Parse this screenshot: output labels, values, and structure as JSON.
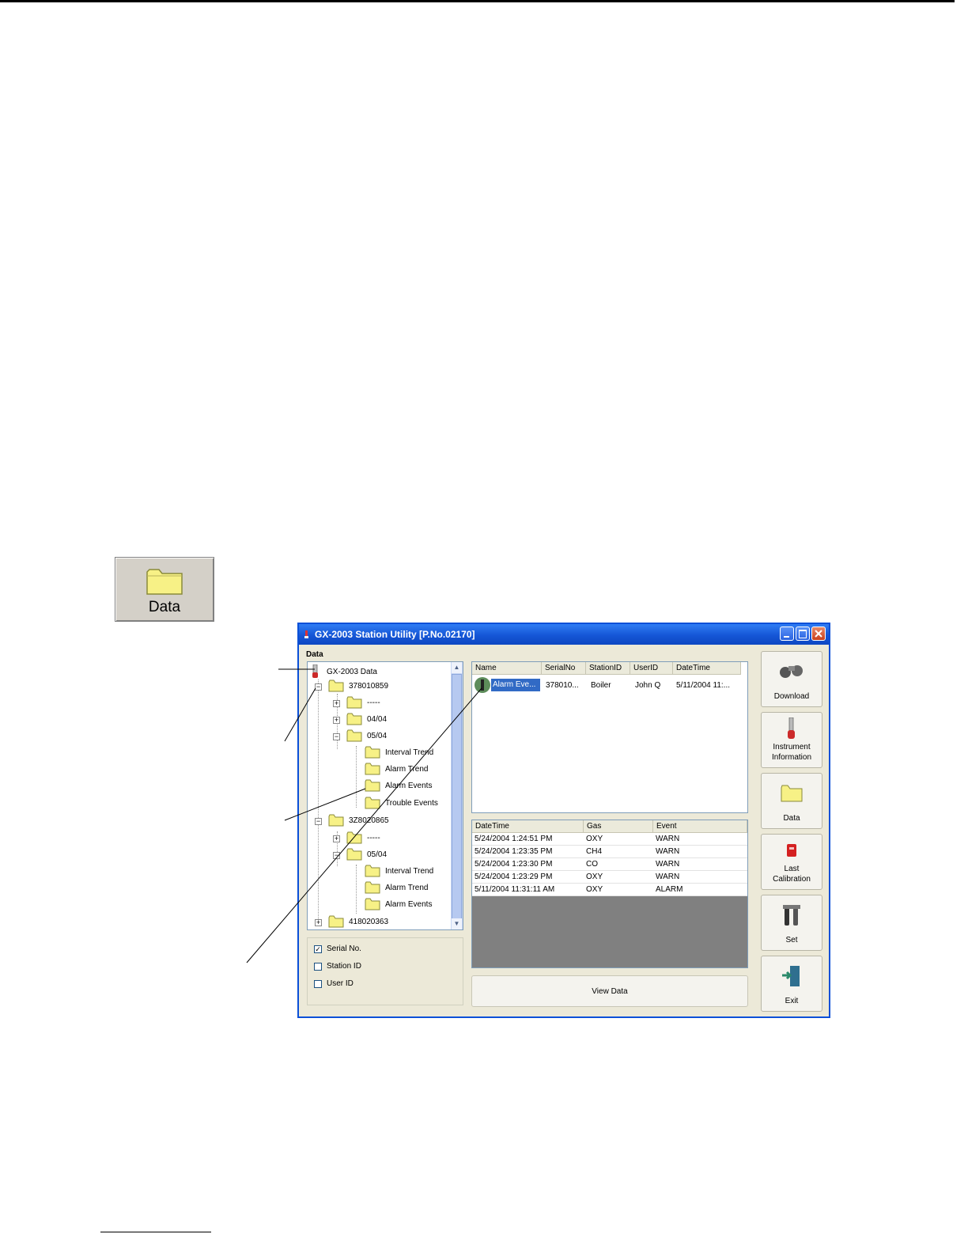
{
  "button": {
    "label": "Data"
  },
  "window": {
    "title": "GX-2003 Station Utility [P.No.02170]",
    "panel_label": "Data"
  },
  "tree": {
    "root": "GX-2003 Data",
    "nodes": [
      {
        "label": "378010859",
        "expander": "−"
      },
      {
        "label": "-----",
        "expander": "+"
      },
      {
        "label": "04/04",
        "expander": "+"
      },
      {
        "label": "05/04",
        "expander": "−"
      },
      {
        "label": "Interval Trend"
      },
      {
        "label": "Alarm Trend"
      },
      {
        "label": "Alarm Events"
      },
      {
        "label": "Trouble Events"
      },
      {
        "label": "3Z8020865",
        "expander": "−"
      },
      {
        "label": "-----",
        "expander": "+"
      },
      {
        "label": "05/04",
        "expander": "−"
      },
      {
        "label": "Interval Trend"
      },
      {
        "label": "Alarm Trend"
      },
      {
        "label": "Alarm Events"
      },
      {
        "label": "418020363",
        "expander": "+"
      }
    ]
  },
  "filters": [
    {
      "label": "Serial No.",
      "checked": "✓"
    },
    {
      "label": "Station ID",
      "checked": ""
    },
    {
      "label": "User ID",
      "checked": ""
    }
  ],
  "file_list": {
    "headers": [
      "Name",
      "SerialNo",
      "StationID",
      "UserID",
      "DateTime"
    ],
    "rows": [
      {
        "name": "Alarm Eve...",
        "serial": "378010...",
        "station": "Boiler",
        "user": "John Q",
        "datetime": "5/11/2004 11:..."
      }
    ]
  },
  "event_list": {
    "headers": [
      "DateTime",
      "Gas",
      "Event"
    ],
    "rows": [
      {
        "datetime": "5/24/2004 1:24:51 PM",
        "gas": "OXY",
        "event": "WARN"
      },
      {
        "datetime": "5/24/2004 1:23:35 PM",
        "gas": "CH4",
        "event": "WARN"
      },
      {
        "datetime": "5/24/2004 1:23:30 PM",
        "gas": "CO",
        "event": "WARN"
      },
      {
        "datetime": "5/24/2004 1:23:29 PM",
        "gas": "OXY",
        "event": "WARN"
      },
      {
        "datetime": "5/11/2004 11:31:11 AM",
        "gas": "OXY",
        "event": "ALARM"
      }
    ]
  },
  "view_button": "View Data",
  "side_buttons": [
    {
      "label": "Download",
      "icon": "download-icon"
    },
    {
      "label": "Instrument Information",
      "icon": "instrument-icon"
    },
    {
      "label": "Data",
      "icon": "folder-icon"
    },
    {
      "label": "Last Calibration",
      "icon": "calibration-icon"
    },
    {
      "label": "Set",
      "icon": "tools-icon"
    },
    {
      "label": "Exit",
      "icon": "exit-door-icon"
    }
  ],
  "colors": {
    "titlebar": "#1556d6",
    "folder": "#f6f08a",
    "selection": "#316ac5",
    "empty_area": "#808080"
  }
}
